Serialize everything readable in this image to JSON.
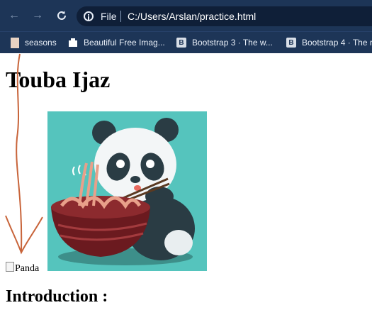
{
  "browser": {
    "omnibox": {
      "scheme_label": "File",
      "url": "C:/Users/Arslan/practice.html"
    },
    "bookmarks": [
      {
        "label": "seasons"
      },
      {
        "label": "Beautiful Free Imag..."
      },
      {
        "label": "Bootstrap 3 · The w...",
        "icon_letter": "B"
      },
      {
        "label": "Bootstrap 4 · The r",
        "icon_letter": "B"
      }
    ],
    "colors": {
      "chrome": "#1d3557",
      "omnibox": "#0f1f38"
    }
  },
  "page": {
    "title": "Touba Ijaz",
    "broken_image_alt": "Panda",
    "section_heading": "Introduction :",
    "annotation_color": "#c8643a"
  }
}
